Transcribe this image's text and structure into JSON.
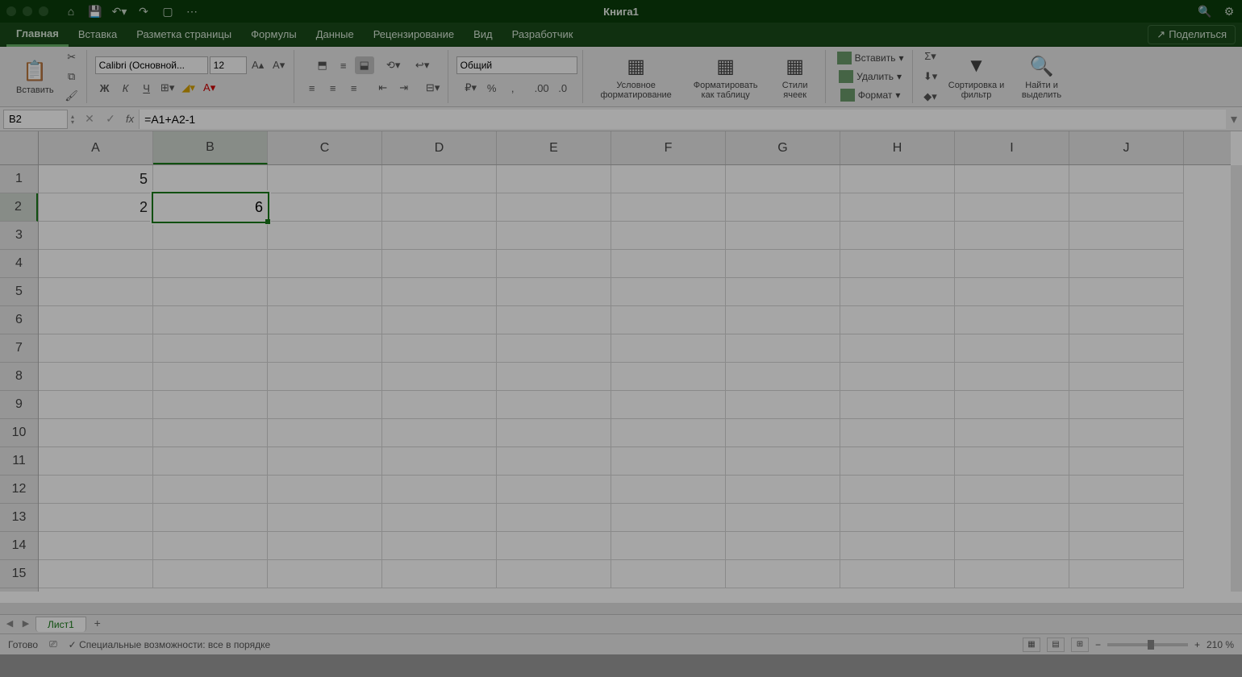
{
  "titlebar": {
    "title": "Книга1"
  },
  "tabs": {
    "items": [
      "Главная",
      "Вставка",
      "Разметка страницы",
      "Формулы",
      "Данные",
      "Рецензирование",
      "Вид",
      "Разработчик"
    ],
    "active": 0,
    "share": "Поделиться"
  },
  "ribbon": {
    "paste": "Вставить",
    "font_name": "Calibri (Основной...",
    "font_size": "12",
    "bold": "Ж",
    "italic": "К",
    "underline": "Ч",
    "number_format": "Общий",
    "cond_fmt": "Условное форматирование",
    "fmt_table": "Форматировать как таблицу",
    "cell_styles": "Стили ячеек",
    "insert": "Вставить",
    "delete": "Удалить",
    "format": "Формат",
    "sort": "Сортировка и фильтр",
    "find": "Найти и выделить"
  },
  "formula_bar": {
    "name_box": "B2",
    "formula": "=A1+A2-1",
    "fx": "fx"
  },
  "grid": {
    "columns": [
      "A",
      "B",
      "C",
      "D",
      "E",
      "F",
      "G",
      "H",
      "I",
      "J"
    ],
    "rows": [
      1,
      2,
      3,
      4,
      5,
      6,
      7,
      8,
      9,
      10,
      11,
      12,
      13,
      14,
      15
    ],
    "cells": {
      "A1": "5",
      "A2": "2",
      "B2": "6"
    },
    "selected": {
      "ref": "B2",
      "col": 1,
      "row": 1
    }
  },
  "sheets": {
    "active": "Лист1"
  },
  "status": {
    "ready": "Готово",
    "accessibility": "Специальные возможности: все в порядке",
    "zoom": "210 %"
  }
}
